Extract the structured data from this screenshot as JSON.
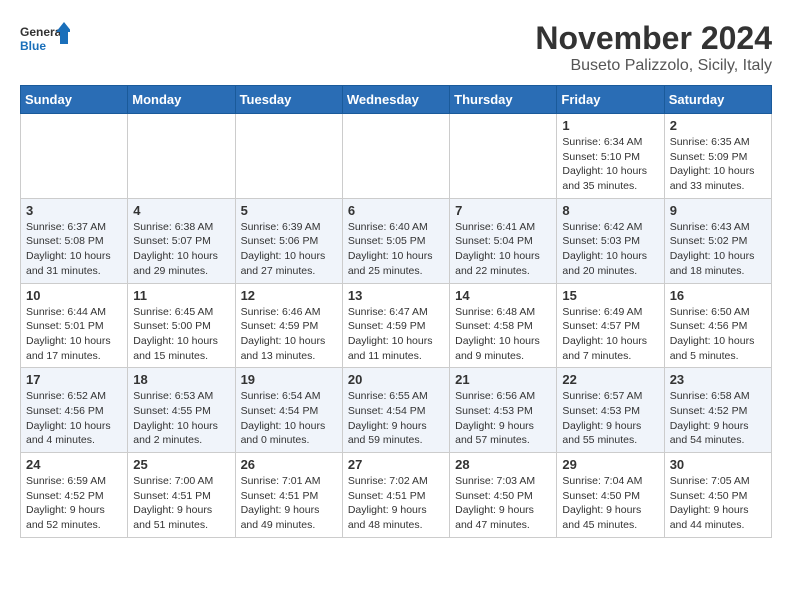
{
  "logo": {
    "general": "General",
    "blue": "Blue"
  },
  "title": "November 2024",
  "subtitle": "Buseto Palizzolo, Sicily, Italy",
  "days_of_week": [
    "Sunday",
    "Monday",
    "Tuesday",
    "Wednesday",
    "Thursday",
    "Friday",
    "Saturday"
  ],
  "weeks": [
    [
      {
        "day": "",
        "info": ""
      },
      {
        "day": "",
        "info": ""
      },
      {
        "day": "",
        "info": ""
      },
      {
        "day": "",
        "info": ""
      },
      {
        "day": "",
        "info": ""
      },
      {
        "day": "1",
        "info": "Sunrise: 6:34 AM\nSunset: 5:10 PM\nDaylight: 10 hours and 35 minutes."
      },
      {
        "day": "2",
        "info": "Sunrise: 6:35 AM\nSunset: 5:09 PM\nDaylight: 10 hours and 33 minutes."
      }
    ],
    [
      {
        "day": "3",
        "info": "Sunrise: 6:37 AM\nSunset: 5:08 PM\nDaylight: 10 hours and 31 minutes."
      },
      {
        "day": "4",
        "info": "Sunrise: 6:38 AM\nSunset: 5:07 PM\nDaylight: 10 hours and 29 minutes."
      },
      {
        "day": "5",
        "info": "Sunrise: 6:39 AM\nSunset: 5:06 PM\nDaylight: 10 hours and 27 minutes."
      },
      {
        "day": "6",
        "info": "Sunrise: 6:40 AM\nSunset: 5:05 PM\nDaylight: 10 hours and 25 minutes."
      },
      {
        "day": "7",
        "info": "Sunrise: 6:41 AM\nSunset: 5:04 PM\nDaylight: 10 hours and 22 minutes."
      },
      {
        "day": "8",
        "info": "Sunrise: 6:42 AM\nSunset: 5:03 PM\nDaylight: 10 hours and 20 minutes."
      },
      {
        "day": "9",
        "info": "Sunrise: 6:43 AM\nSunset: 5:02 PM\nDaylight: 10 hours and 18 minutes."
      }
    ],
    [
      {
        "day": "10",
        "info": "Sunrise: 6:44 AM\nSunset: 5:01 PM\nDaylight: 10 hours and 17 minutes."
      },
      {
        "day": "11",
        "info": "Sunrise: 6:45 AM\nSunset: 5:00 PM\nDaylight: 10 hours and 15 minutes."
      },
      {
        "day": "12",
        "info": "Sunrise: 6:46 AM\nSunset: 4:59 PM\nDaylight: 10 hours and 13 minutes."
      },
      {
        "day": "13",
        "info": "Sunrise: 6:47 AM\nSunset: 4:59 PM\nDaylight: 10 hours and 11 minutes."
      },
      {
        "day": "14",
        "info": "Sunrise: 6:48 AM\nSunset: 4:58 PM\nDaylight: 10 hours and 9 minutes."
      },
      {
        "day": "15",
        "info": "Sunrise: 6:49 AM\nSunset: 4:57 PM\nDaylight: 10 hours and 7 minutes."
      },
      {
        "day": "16",
        "info": "Sunrise: 6:50 AM\nSunset: 4:56 PM\nDaylight: 10 hours and 5 minutes."
      }
    ],
    [
      {
        "day": "17",
        "info": "Sunrise: 6:52 AM\nSunset: 4:56 PM\nDaylight: 10 hours and 4 minutes."
      },
      {
        "day": "18",
        "info": "Sunrise: 6:53 AM\nSunset: 4:55 PM\nDaylight: 10 hours and 2 minutes."
      },
      {
        "day": "19",
        "info": "Sunrise: 6:54 AM\nSunset: 4:54 PM\nDaylight: 10 hours and 0 minutes."
      },
      {
        "day": "20",
        "info": "Sunrise: 6:55 AM\nSunset: 4:54 PM\nDaylight: 9 hours and 59 minutes."
      },
      {
        "day": "21",
        "info": "Sunrise: 6:56 AM\nSunset: 4:53 PM\nDaylight: 9 hours and 57 minutes."
      },
      {
        "day": "22",
        "info": "Sunrise: 6:57 AM\nSunset: 4:53 PM\nDaylight: 9 hours and 55 minutes."
      },
      {
        "day": "23",
        "info": "Sunrise: 6:58 AM\nSunset: 4:52 PM\nDaylight: 9 hours and 54 minutes."
      }
    ],
    [
      {
        "day": "24",
        "info": "Sunrise: 6:59 AM\nSunset: 4:52 PM\nDaylight: 9 hours and 52 minutes."
      },
      {
        "day": "25",
        "info": "Sunrise: 7:00 AM\nSunset: 4:51 PM\nDaylight: 9 hours and 51 minutes."
      },
      {
        "day": "26",
        "info": "Sunrise: 7:01 AM\nSunset: 4:51 PM\nDaylight: 9 hours and 49 minutes."
      },
      {
        "day": "27",
        "info": "Sunrise: 7:02 AM\nSunset: 4:51 PM\nDaylight: 9 hours and 48 minutes."
      },
      {
        "day": "28",
        "info": "Sunrise: 7:03 AM\nSunset: 4:50 PM\nDaylight: 9 hours and 47 minutes."
      },
      {
        "day": "29",
        "info": "Sunrise: 7:04 AM\nSunset: 4:50 PM\nDaylight: 9 hours and 45 minutes."
      },
      {
        "day": "30",
        "info": "Sunrise: 7:05 AM\nSunset: 4:50 PM\nDaylight: 9 hours and 44 minutes."
      }
    ]
  ]
}
